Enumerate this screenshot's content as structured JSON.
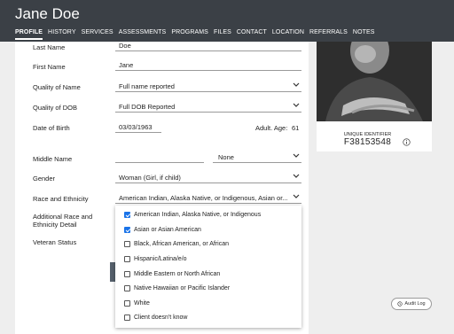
{
  "header": {
    "name": "Jane Doe"
  },
  "nav": {
    "tabs": [
      {
        "label": "PROFILE",
        "active": true
      },
      {
        "label": "HISTORY",
        "active": false
      },
      {
        "label": "SERVICES",
        "active": false
      },
      {
        "label": "ASSESSMENTS",
        "active": false
      },
      {
        "label": "PROGRAMS",
        "active": false
      },
      {
        "label": "FILES",
        "active": false
      },
      {
        "label": "CONTACT",
        "active": false
      },
      {
        "label": "LOCATION",
        "active": false
      },
      {
        "label": "REFERRALS",
        "active": false
      },
      {
        "label": "NOTES",
        "active": false
      }
    ]
  },
  "form": {
    "last_name": {
      "label": "Last Name",
      "value": "Doe"
    },
    "first_name": {
      "label": "First Name",
      "value": "Jane"
    },
    "quality_of_name": {
      "label": "Quality of Name",
      "value": "Full name reported"
    },
    "quality_of_dob": {
      "label": "Quality of DOB",
      "value": "Full DOB Reported"
    },
    "dob": {
      "label": "Date of Birth",
      "value": "03/03/1963",
      "age_label": "Adult. Age:",
      "age_value": "61"
    },
    "middle_name": {
      "label": "Middle Name",
      "suffix_value": "None"
    },
    "gender": {
      "label": "Gender",
      "value": "Woman (Girl, if child)"
    },
    "race": {
      "label": "Race and Ethnicity",
      "value": "American Indian, Alaska Native, or Indigenous, Asian or..."
    },
    "additional_race": {
      "label": "Additional Race and Ethnicity Detail"
    },
    "veteran": {
      "label": "Veteran Status"
    }
  },
  "race_options": [
    {
      "label": "American Indian, Alaska Native, or Indigenous",
      "checked": true
    },
    {
      "label": "Asian or Asian American",
      "checked": true
    },
    {
      "label": "Black, African American, or African",
      "checked": false
    },
    {
      "label": "Hispanic/Latina/e/o",
      "checked": false
    },
    {
      "label": "Middle Eastern or North African",
      "checked": false
    },
    {
      "label": "Native Hawaiian or Pacific Islander",
      "checked": false
    },
    {
      "label": "White",
      "checked": false
    },
    {
      "label": "Client doesn't know",
      "checked": false
    }
  ],
  "profile_card": {
    "uid_label": "UNIQUE IDENTIFIER",
    "uid_value": "F38153548",
    "info_icon": "info-icon"
  },
  "audit": {
    "label": "Audit Log",
    "icon": "history-icon"
  },
  "colors": {
    "header": "#3b4046",
    "checkbox": "#1a73e8"
  }
}
